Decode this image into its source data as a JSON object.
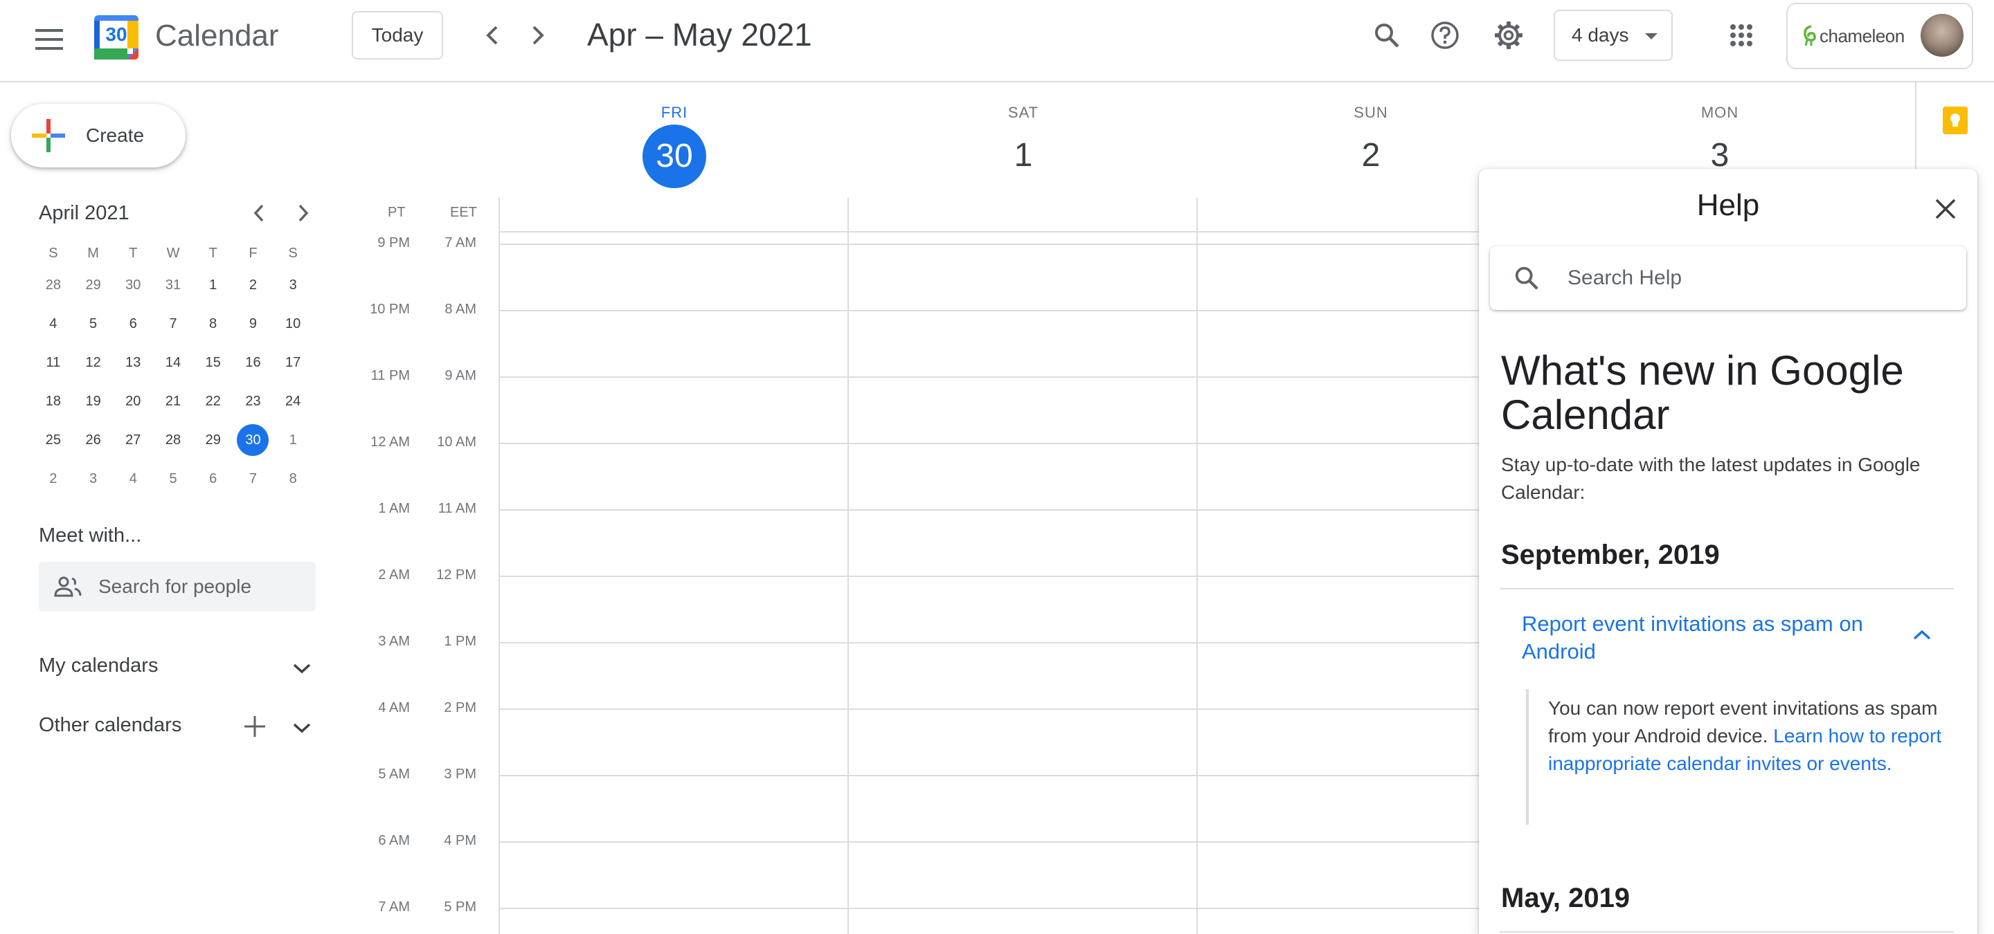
{
  "header": {
    "app_title": "Calendar",
    "logo_day": "30",
    "today_label": "Today",
    "date_range": "Apr – May 2021",
    "view_label": "4 days",
    "account_brand": "chameleon"
  },
  "sidebar": {
    "create_label": "Create",
    "mini_calendar": {
      "month_label": "April 2021",
      "weekday_headers": [
        "S",
        "M",
        "T",
        "W",
        "T",
        "F",
        "S"
      ],
      "weeks": [
        [
          {
            "d": "28",
            "muted": true
          },
          {
            "d": "29",
            "muted": true
          },
          {
            "d": "30",
            "muted": true
          },
          {
            "d": "31",
            "muted": true
          },
          {
            "d": "1"
          },
          {
            "d": "2"
          },
          {
            "d": "3"
          }
        ],
        [
          {
            "d": "4"
          },
          {
            "d": "5"
          },
          {
            "d": "6"
          },
          {
            "d": "7"
          },
          {
            "d": "8"
          },
          {
            "d": "9"
          },
          {
            "d": "10"
          }
        ],
        [
          {
            "d": "11"
          },
          {
            "d": "12"
          },
          {
            "d": "13"
          },
          {
            "d": "14"
          },
          {
            "d": "15"
          },
          {
            "d": "16"
          },
          {
            "d": "17"
          }
        ],
        [
          {
            "d": "18"
          },
          {
            "d": "19"
          },
          {
            "d": "20"
          },
          {
            "d": "21"
          },
          {
            "d": "22"
          },
          {
            "d": "23"
          },
          {
            "d": "24"
          }
        ],
        [
          {
            "d": "25"
          },
          {
            "d": "26"
          },
          {
            "d": "27"
          },
          {
            "d": "28"
          },
          {
            "d": "29"
          },
          {
            "d": "30",
            "selected": true
          },
          {
            "d": "1",
            "muted": true
          }
        ],
        [
          {
            "d": "2",
            "muted": true
          },
          {
            "d": "3",
            "muted": true
          },
          {
            "d": "4",
            "muted": true
          },
          {
            "d": "5",
            "muted": true
          },
          {
            "d": "6",
            "muted": true
          },
          {
            "d": "7",
            "muted": true
          },
          {
            "d": "8",
            "muted": true
          }
        ]
      ]
    },
    "meet_title": "Meet with...",
    "people_search_placeholder": "Search for people",
    "my_calendars": "My calendars",
    "other_calendars": "Other calendars"
  },
  "grid": {
    "days": [
      {
        "name": "FRI",
        "num": "30",
        "today": true
      },
      {
        "name": "SAT",
        "num": "1"
      },
      {
        "name": "SUN",
        "num": "2"
      },
      {
        "name": "MON",
        "num": "3"
      }
    ],
    "tz_primary": "PT",
    "tz_secondary": "EET",
    "hours": [
      {
        "pt": "9 PM",
        "eet": "7 AM"
      },
      {
        "pt": "10 PM",
        "eet": "8 AM"
      },
      {
        "pt": "11 PM",
        "eet": "9 AM"
      },
      {
        "pt": "12 AM",
        "eet": "10 AM"
      },
      {
        "pt": "1 AM",
        "eet": "11 AM"
      },
      {
        "pt": "2 AM",
        "eet": "12 PM"
      },
      {
        "pt": "3 AM",
        "eet": "1 PM"
      },
      {
        "pt": "4 AM",
        "eet": "2 PM"
      },
      {
        "pt": "5 AM",
        "eet": "3 PM"
      },
      {
        "pt": "6 AM",
        "eet": "4 PM"
      },
      {
        "pt": "7 AM",
        "eet": "5 PM"
      }
    ]
  },
  "help": {
    "title": "Help",
    "search_placeholder": "Search Help",
    "whats_new_title": "What's new in Google Calendar",
    "whats_new_sub": "Stay up-to-date with the latest updates in Google Calendar:",
    "section1_title": "September, 2019",
    "article_title": "Report event invitations as spam on Android",
    "article_body": "You can now report event invitations as spam from your Android device. ",
    "article_link": "Learn how to report inappropriate calendar invites or events.",
    "section2_title": "May, 2019"
  },
  "colors": {
    "accent": "#1a73e8",
    "divider": "#dadce0",
    "text": "#3c4043",
    "muted_text": "#70757a",
    "keep_yellow": "#fbbc04"
  }
}
